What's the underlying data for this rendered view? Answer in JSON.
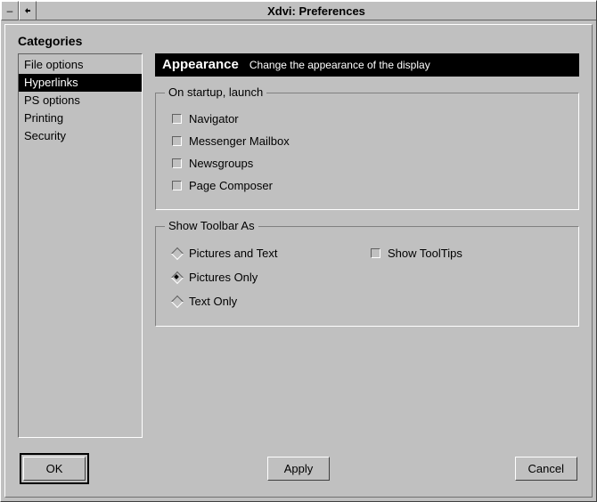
{
  "window": {
    "title": "Xdvi: Preferences"
  },
  "categories": {
    "label": "Categories",
    "items": [
      {
        "label": "File options"
      },
      {
        "label": "Hyperlinks"
      },
      {
        "label": "PS options"
      },
      {
        "label": "Printing"
      },
      {
        "label": "Security"
      }
    ],
    "selected_index": 1
  },
  "header": {
    "title": "Appearance",
    "subtitle": "Change the appearance of the display"
  },
  "groups": {
    "startup": {
      "legend": "On startup, launch",
      "options": [
        {
          "label": "Navigator"
        },
        {
          "label": "Messenger Mailbox"
        },
        {
          "label": "Newsgroups"
        },
        {
          "label": "Page Composer"
        }
      ]
    },
    "toolbar": {
      "legend": "Show Toolbar As",
      "radios": [
        {
          "label": "Pictures and Text"
        },
        {
          "label": "Pictures Only"
        },
        {
          "label": "Text Only"
        }
      ],
      "selected_index": 1,
      "tooltips_label": "Show ToolTips"
    }
  },
  "buttons": {
    "ok": "OK",
    "apply": "Apply",
    "cancel": "Cancel"
  }
}
